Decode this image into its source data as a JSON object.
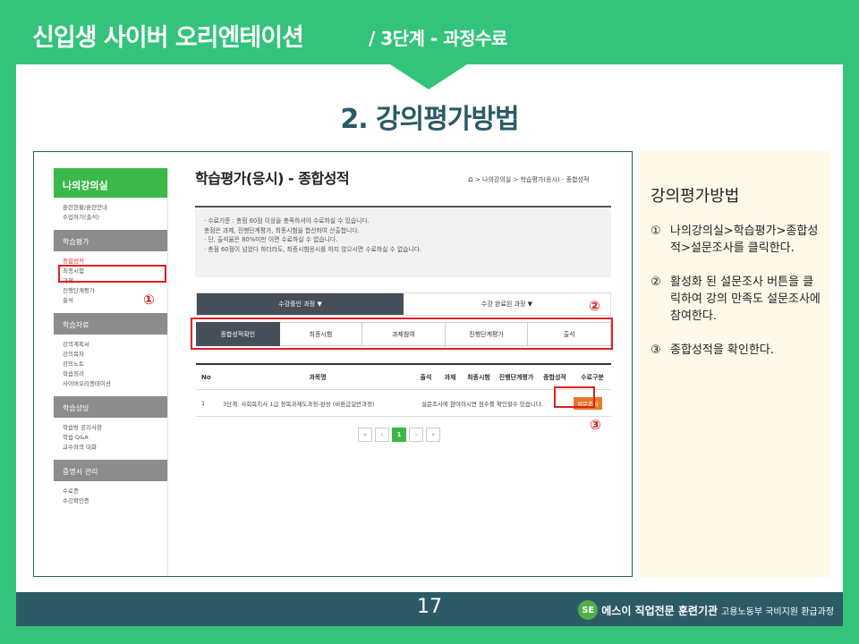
{
  "header": {
    "title": "신입생 사이버 오리엔테이션",
    "subtitle": "/ 3단계 - 과정수료"
  },
  "section_title": "2. 강의평가방법",
  "screenshot": {
    "sidebar": {
      "head": "나의강의실",
      "groups": [
        {
          "label": "",
          "items": [
            "훈련현황/훈련안내",
            "수업하기(출석)"
          ]
        },
        {
          "label": "학습평가",
          "items": [
            "종합성적",
            "최종시험",
            "과제",
            "진행단계평가",
            "출석"
          ]
        },
        {
          "label": "학습자료",
          "items": [
            "강의계획서",
            "강의목차",
            "강의노트",
            "학습정리",
            "사이버오리엔테이션"
          ]
        },
        {
          "label": "학습상담",
          "items": [
            "학습방 공지사항",
            "학습 Q&A",
            "교수와의 대화"
          ]
        },
        {
          "label": "증명서 관리",
          "items": [
            "수료증",
            "수강확인증"
          ]
        }
      ],
      "active_item": "종합성적"
    },
    "page_title": "학습평가(응시) - 종합성적",
    "breadcrumb": "> 나의강의실 > 학습평가(응시) - 종합성적",
    "notice": [
      "· 수료기준 : 총점 60점 이상을 충족하셔야 수료하실 수 있습니다.",
      "  총점은 과제, 진행단계평가, 최종시험을 합산하여 산출합니다.",
      "· 단, 출석율은 80%미만 이면 수료하실 수 없습니다.",
      "· 총점 60점이 넘었다 하더라도, 최종시험응시를 하지 않으시면 수료하실 수 없습니다."
    ],
    "top_tabs": [
      "수강중인 과정 ▼",
      "수강 완료된 과정 ▼"
    ],
    "sub_tabs": [
      "종합성적확인",
      "최종시험",
      "과제참여",
      "진행단계평가",
      "출석"
    ],
    "table": {
      "headers": [
        "No",
        "과목명",
        "출석",
        "과제",
        "최종시험",
        "진행단계평가",
        "종합성적",
        "수료구분"
      ],
      "row": {
        "no": "1",
        "title": "3단계: 사회복지사 1급 정복과제도과정-완성 (비환급일반과정)",
        "message": "설문조사에 참여하시면 점수를 확인할수 있습니다.",
        "survey_button": "설문조사"
      }
    },
    "pager": [
      "«",
      "‹",
      "1",
      "›",
      "»"
    ],
    "markers": [
      "①",
      "②",
      "③"
    ]
  },
  "instructions": {
    "title": "강의평가방법",
    "steps": [
      {
        "num": "①",
        "text": "나의강의실>학습평가>종합성적>설문조사를 클릭한다."
      },
      {
        "num": "②",
        "text": "활성화 된 설문조사 버튼을 클릭하여 강의 만족도 설문조사에 참여한다."
      },
      {
        "num": "③",
        "text": "종합성적을 확인한다."
      }
    ]
  },
  "footer": {
    "page_number": "17",
    "logo_text": "SE",
    "brand": "에스이 직업전문 훈련기관",
    "brand_sub": "고용노동부 국비지원 환급과정"
  }
}
